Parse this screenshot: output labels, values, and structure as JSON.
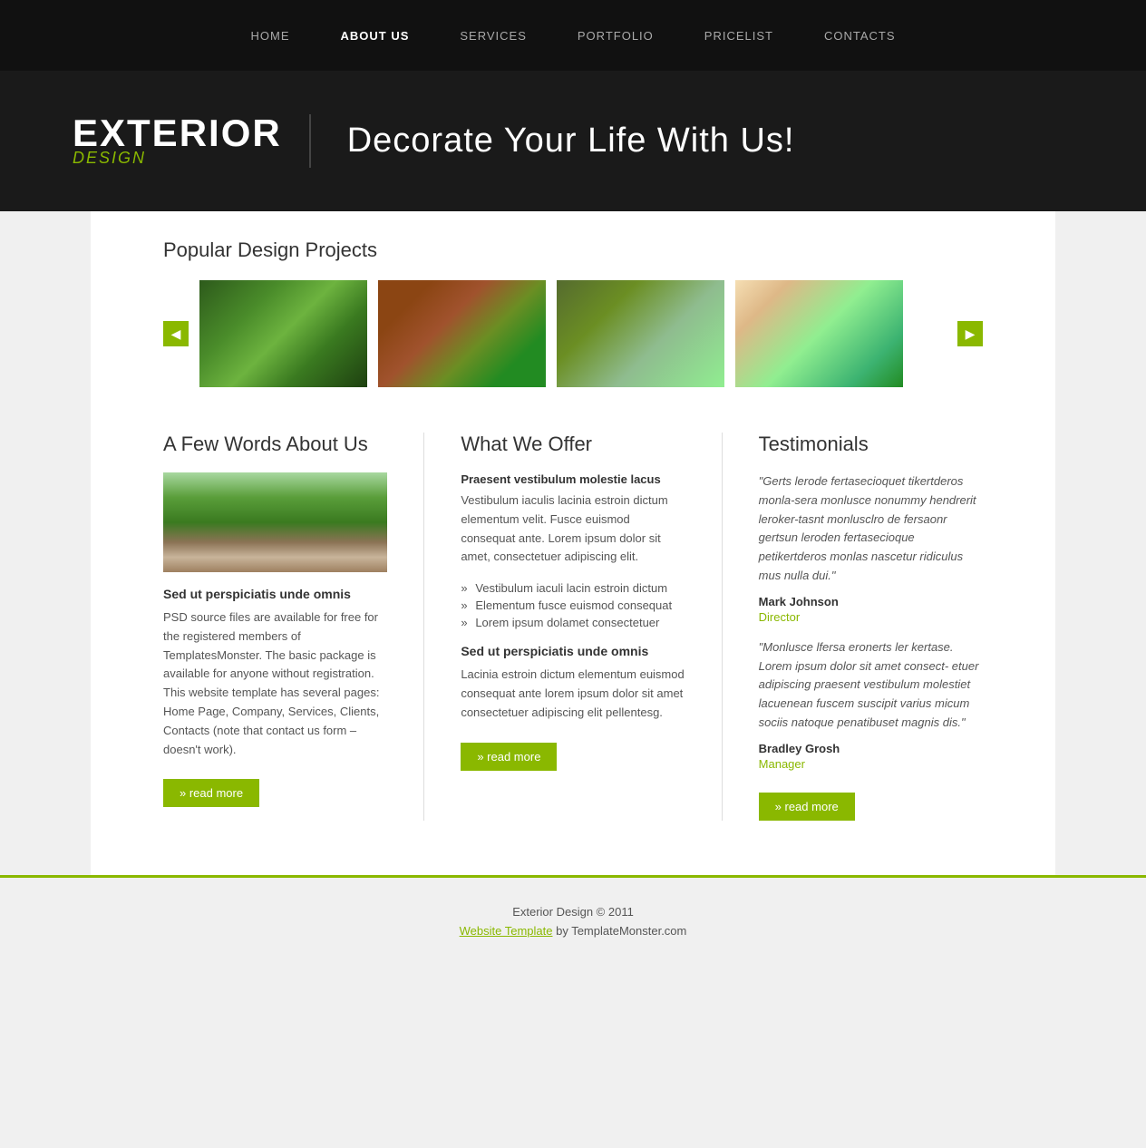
{
  "nav": {
    "items": [
      {
        "label": "HOME",
        "active": false
      },
      {
        "label": "ABOUT US",
        "active": true
      },
      {
        "label": "SERVICES",
        "active": false
      },
      {
        "label": "PORTFOLIO",
        "active": false
      },
      {
        "label": "PRICELIST",
        "active": false
      },
      {
        "label": "CONTACTS",
        "active": false
      }
    ]
  },
  "banner": {
    "logo_main": "EXTERIOR",
    "logo_sub": "DESIGN",
    "tagline": "Decorate Your Life With Us!"
  },
  "projects": {
    "title": "Popular Design Projects"
  },
  "about": {
    "title": "A Few Words About Us",
    "subtitle": "Sed ut perspiciatis unde omnis",
    "text": "PSD source files are available for free for the registered members of TemplatesMonster. The basic package is available for anyone without registration. This website template has several pages: Home Page, Company, Services, Clients, Contacts (note that contact us form – doesn't work).",
    "read_more": "» read more"
  },
  "offer": {
    "title": "What We Offer",
    "intro_bold": "Praesent vestibulum molestie lacus",
    "intro_text": "Vestibulum iaculis lacinia estroin dictum elementum velit. Fusce euismod consequat ante. Lorem ipsum dolor sit amet, consectetuer adipiscing elit.",
    "list": [
      "Vestibulum iaculi lacin estroin dictum",
      "Elementum fusce euismod consequat",
      "Lorem ipsum dolamet consectetuer"
    ],
    "subtitle": "Sed ut perspiciatis unde omnis",
    "sub_text": "Lacinia estroin dictum elementum euismod consequat ante lorem ipsum dolor sit amet consectetuer adipiscing elit pellentesg.",
    "read_more": "» read more"
  },
  "testimonials": {
    "title": "Testimonials",
    "items": [
      {
        "quote": "\"Gerts lerode fertasecioquet tikertderos monla-sera monlusce nonummy hendrerit leroker-tasnt monlusclro de fersaonr gertsun leroden fertasecioque petikertderos monlas nascetur ridiculus mus nulla dui.\"",
        "name": "Mark Johnson",
        "role": "Director"
      },
      {
        "quote": "\"Monlusce lfersa eronerts ler kertase. Lorem ipsum dolor sit amet consect- etuer adipiscing praesent vestibulum molestiet lacuenean fuscem suscipit varius micum sociis natoque penatibuset magnis dis.\"",
        "name": "Bradley Grosh",
        "role": "Manager"
      }
    ],
    "read_more": "» read more"
  },
  "footer": {
    "copyright": "Exterior Design © 2011",
    "link_text": "Website Template",
    "link_suffix": " by TemplateMonster.com"
  }
}
